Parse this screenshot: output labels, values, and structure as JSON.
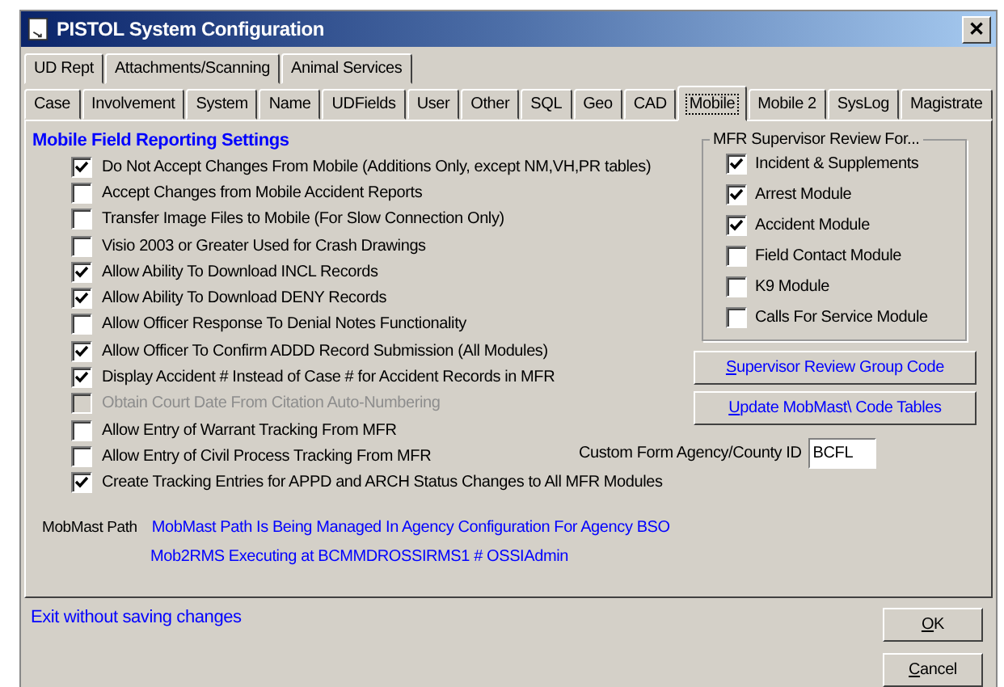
{
  "window": {
    "title": "PISTOL System Configuration",
    "close": "✕"
  },
  "tab_rows": [
    [
      {
        "label": "UD Rept",
        "selected": false
      },
      {
        "label": "Attachments/Scanning",
        "selected": false
      },
      {
        "label": "Animal Services",
        "selected": false
      }
    ],
    [
      {
        "label": "Case",
        "selected": false
      },
      {
        "label": "Involvement",
        "selected": false
      },
      {
        "label": "System",
        "selected": false
      },
      {
        "label": "Name",
        "selected": false
      },
      {
        "label": "UDFields",
        "selected": false
      },
      {
        "label": "User",
        "selected": false
      },
      {
        "label": "Other",
        "selected": false
      },
      {
        "label": "SQL",
        "selected": false
      },
      {
        "label": "Geo",
        "selected": false
      },
      {
        "label": "CAD",
        "selected": false
      },
      {
        "label": "Mobile",
        "selected": true
      },
      {
        "label": "Mobile 2",
        "selected": false
      },
      {
        "label": "SysLog",
        "selected": false
      },
      {
        "label": "Magistrate",
        "selected": false
      }
    ]
  ],
  "section_title": "Mobile Field Reporting Settings",
  "settings": [
    {
      "label": "Do Not Accept Changes From Mobile (Additions Only, except NM,VH,PR tables)",
      "checked": true,
      "disabled": false
    },
    {
      "label": "Accept Changes from Mobile Accident Reports",
      "checked": false,
      "disabled": false
    },
    {
      "label": "Transfer Image Files to Mobile (For Slow Connection Only)",
      "checked": false,
      "disabled": false
    },
    {
      "label": "Visio 2003 or Greater Used for Crash Drawings",
      "checked": false,
      "disabled": false
    },
    {
      "label": "Allow Ability To Download INCL Records",
      "checked": true,
      "disabled": false
    },
    {
      "label": "Allow Ability To Download DENY Records",
      "checked": true,
      "disabled": false
    },
    {
      "label": "Allow Officer Response To Denial Notes Functionality",
      "checked": false,
      "disabled": false
    },
    {
      "label": "Allow Officer To Confirm ADDD Record Submission (All Modules)",
      "checked": true,
      "disabled": false
    },
    {
      "label": "Display Accident # Instead of Case # for Accident Records in MFR",
      "checked": true,
      "disabled": false
    },
    {
      "label": "Obtain Court Date From Citation Auto-Numbering",
      "checked": false,
      "disabled": true
    },
    {
      "label": "Allow Entry of Warrant Tracking From MFR",
      "checked": false,
      "disabled": false
    },
    {
      "label": "Allow Entry of Civil Process Tracking From MFR",
      "checked": false,
      "disabled": false
    },
    {
      "label": "Create Tracking Entries for APPD and ARCH Status Changes to All MFR Modules",
      "checked": true,
      "disabled": false
    }
  ],
  "review_group": {
    "title": "MFR Supervisor Review For...",
    "items": [
      {
        "label": "Incident & Supplements",
        "checked": true
      },
      {
        "label": "Arrest Module",
        "checked": true
      },
      {
        "label": "Accident Module",
        "checked": true
      },
      {
        "label": "Field Contact Module",
        "checked": false
      },
      {
        "label": "K9 Module",
        "checked": false
      },
      {
        "label": "Calls For Service Module",
        "checked": false
      }
    ]
  },
  "side_buttons": [
    "Supervisor Review Group Code",
    "Update MobMast\\ Code Tables"
  ],
  "custom_form": {
    "label": "Custom Form Agency/County ID",
    "value": "BCFL"
  },
  "mobmast": {
    "label": "MobMast Path",
    "path": "MobMast Path Is Being Managed In Agency Configuration For Agency BSO",
    "status": "Mob2RMS Executing at BCMMDROSSIRMS1 # OSSIAdmin"
  },
  "exit_link": "Exit without saving changes",
  "buttons": [
    "OK",
    "Cancel"
  ]
}
